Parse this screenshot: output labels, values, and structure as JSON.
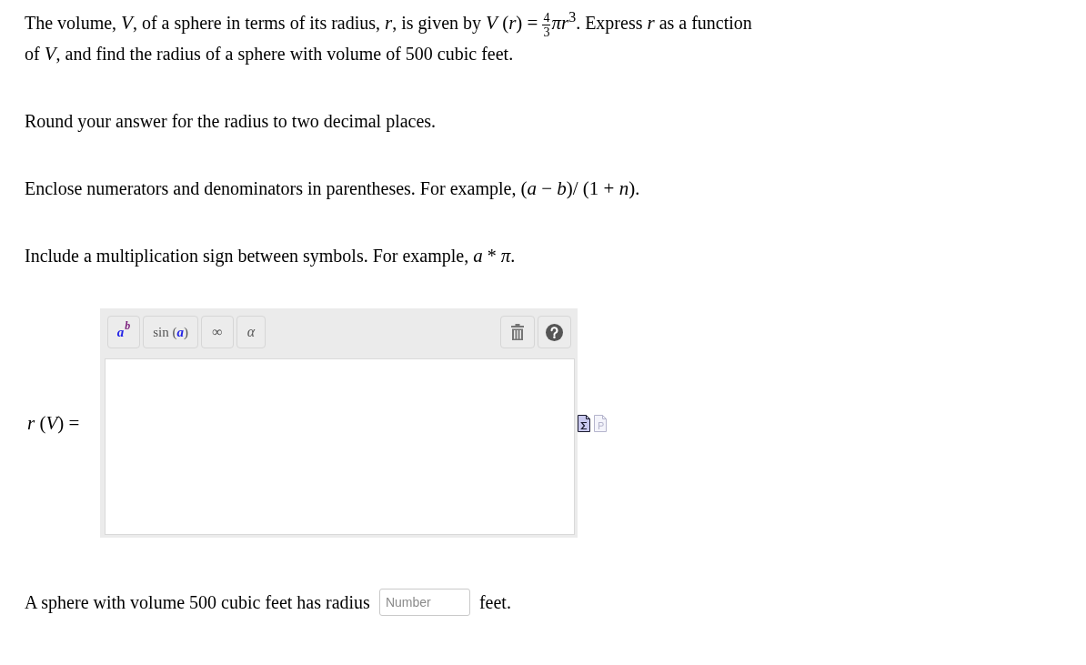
{
  "question": {
    "parts": [
      {
        "kind": "text",
        "text": "The volume, "
      },
      {
        "kind": "math",
        "text": "*V*"
      },
      {
        "kind": "text",
        "text": ", of a sphere in terms of its radius, "
      },
      {
        "kind": "math",
        "text": "*r*"
      },
      {
        "kind": "text",
        "text": ", is given by "
      },
      {
        "kind": "math",
        "text": "*V* (*r*) ="
      },
      {
        "kind": "fraction",
        "numerator": "4",
        "denominator": "3"
      },
      {
        "kind": "math",
        "text": "*πr*$^{3}$"
      },
      {
        "kind": "text",
        "text": ". Express "
      },
      {
        "kind": "math",
        "text": "*r*"
      },
      {
        "kind": "text",
        "text": " as a function of "
      },
      {
        "kind": "math",
        "text": "*V*"
      },
      {
        "kind": "text",
        "text": ", and find the radius of a sphere with volume of 500 cubic feet."
      }
    ]
  },
  "instructions": [
    {
      "parts": [
        {
          "kind": "text",
          "text": "Round your answer for the radius to two decimal places."
        }
      ]
    },
    {
      "parts": [
        {
          "kind": "text",
          "text": "Enclose numerators and denominators in parentheses. For example, "
        },
        {
          "kind": "math",
          "text": "(*a* − *b*)/ (1 + *n*)"
        },
        {
          "kind": "text",
          "text": "."
        }
      ]
    },
    {
      "parts": [
        {
          "kind": "text",
          "text": "Include a multiplication sign between symbols. For example, "
        },
        {
          "kind": "math",
          "text": "*a*"
        },
        {
          "kind": "text",
          "text": " * "
        },
        {
          "kind": "math",
          "text": "*π*"
        },
        {
          "kind": "text",
          "text": "."
        }
      ]
    }
  ],
  "answer_editor": {
    "label": "*r* (*V*) =",
    "toolbar": [
      {
        "kind": "power",
        "base": "a",
        "exponent": "b"
      },
      {
        "kind": "function",
        "text": "sin (*a*)"
      },
      {
        "kind": "symbol",
        "text": "∞"
      },
      {
        "kind": "symbol",
        "text": "*α*"
      }
    ],
    "input_modes": [
      {
        "kind": "equation",
        "selected": true
      },
      {
        "kind": "text",
        "selected": false
      }
    ]
  },
  "answer_sentence": {
    "before": "A sphere with volume 500 cubic feet has radius",
    "placeholder": "Number",
    "after": "feet."
  }
}
